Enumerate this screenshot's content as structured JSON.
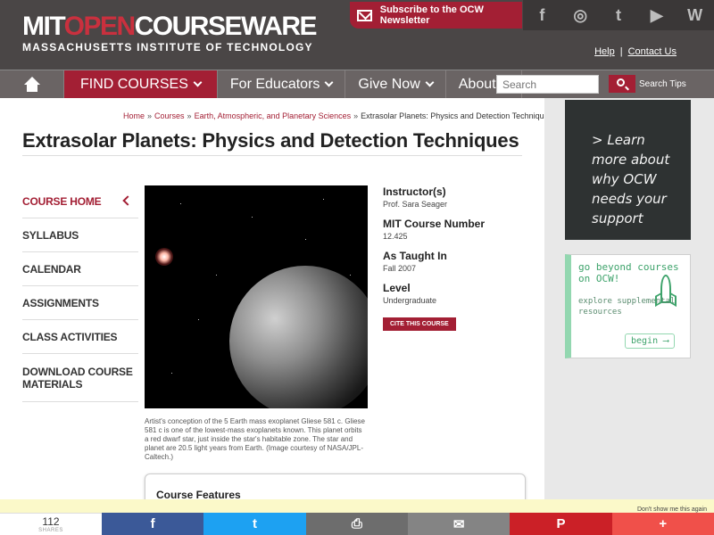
{
  "header": {
    "logo_mit": "MIT",
    "logo_open": "OPEN",
    "logo_courseware": "COURSEWARE",
    "logo_sub": "MASSACHUSETTS INSTITUTE OF TECHNOLOGY",
    "newsletter_label": "Subscribe to the OCW Newsletter",
    "social": [
      "f",
      "◎",
      "t",
      "▶",
      "W"
    ],
    "help_label": "Help",
    "contact_label": "Contact Us"
  },
  "nav": {
    "items": [
      {
        "label": "FIND COURSES",
        "active": true
      },
      {
        "label": "For Educators"
      },
      {
        "label": "Give Now"
      },
      {
        "label": "About"
      }
    ],
    "search_placeholder": "Search",
    "search_tips": "Search Tips"
  },
  "breadcrumb": {
    "home": "Home",
    "courses": "Courses",
    "dept": "Earth, Atmospheric, and Planetary Sciences",
    "current": "Extrasolar Planets: Physics and Detection Techniques",
    "sep": "»"
  },
  "page_title": "Extrasolar Planets: Physics and Detection Techniques",
  "sidebar": {
    "items": [
      {
        "label": "COURSE HOME"
      },
      {
        "label": "SYLLABUS"
      },
      {
        "label": "CALENDAR"
      },
      {
        "label": "ASSIGNMENTS"
      },
      {
        "label": "CLASS ACTIVITIES"
      },
      {
        "label": "DOWNLOAD COURSE MATERIALS"
      }
    ]
  },
  "image_caption": "Artist's conception of the 5 Earth mass exoplanet Gliese 581 c. Gliese 581 c is one of the lowest-mass exoplanets known. This planet orbits a red dwarf star, just inside the star's habitable zone. The star and planet are 20.5 light years from Earth. (Image courtesy of NASA/JPL-Caltech.)",
  "info": {
    "instructor_label": "Instructor(s)",
    "instructor_value": "Prof. Sara Seager",
    "number_label": "MIT Course Number",
    "number_value": "12.425",
    "taught_label": "As Taught In",
    "taught_value": "Fall 2007",
    "level_label": "Level",
    "level_value": "Undergraduate",
    "cite_label": "CITE THIS COURSE"
  },
  "features_title": "Course Features",
  "ads": {
    "chalk_text": "> Learn more about why OCW needs your support",
    "green_line1": "go beyond courses on OCW!",
    "green_line2": "explore supplemental resources",
    "green_begin": "begin ⟶"
  },
  "cookie": {
    "dont_show": "Don't show me this again"
  },
  "share": {
    "count": "112",
    "count_label": "SHARES",
    "buttons": [
      "f",
      "t",
      "⎙",
      "✉",
      "P",
      "+"
    ]
  }
}
